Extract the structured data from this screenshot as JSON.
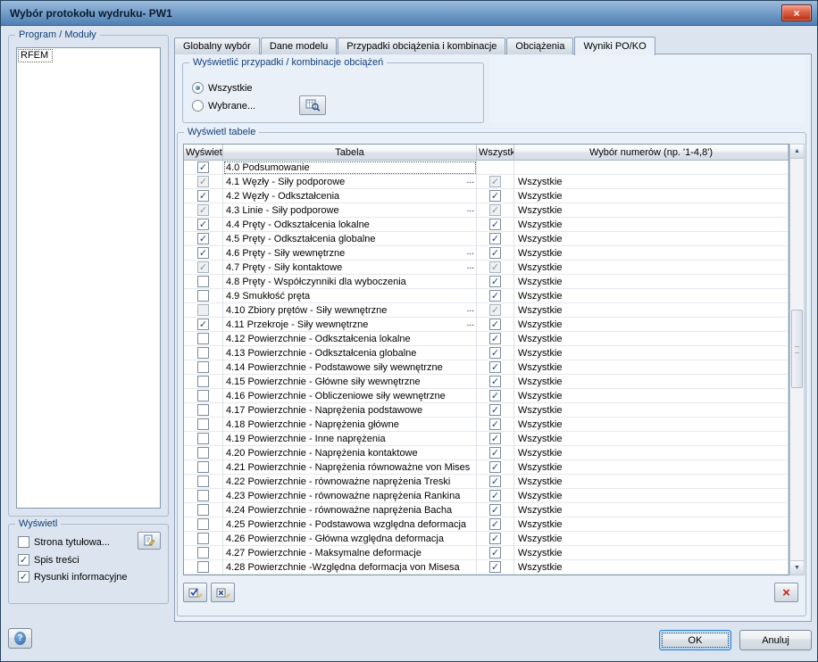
{
  "window": {
    "title": "Wybór protokołu wydruku- PW1"
  },
  "icons": {
    "close": "×",
    "help": "?",
    "dots": "...",
    "scroll_up": "▲",
    "scroll_down": "▼",
    "delete": "×"
  },
  "left": {
    "program_group": "Program / Moduły",
    "program_items": [
      {
        "label": "RFEM",
        "focused": true
      }
    ],
    "display_group": "Wyświetl",
    "options": [
      {
        "label": "Strona tytułowa...",
        "checked": false
      },
      {
        "label": "Spis treści",
        "checked": true
      },
      {
        "label": "Rysunki informacyjne",
        "checked": true
      }
    ]
  },
  "tabs": [
    {
      "label": "Globalny wybór",
      "active": false
    },
    {
      "label": "Dane modelu",
      "active": false
    },
    {
      "label": "Przypadki obciążenia i kombinacje",
      "active": false
    },
    {
      "label": "Obciążenia",
      "active": false
    },
    {
      "label": "Wyniki PO/KO",
      "active": true
    }
  ],
  "cases_group": {
    "label": "Wyświetlić przypadki / kombinacje obciążeń",
    "options": [
      {
        "label": "Wszystkie",
        "selected": true
      },
      {
        "label": "Wybrane...",
        "selected": false
      }
    ]
  },
  "tables_group": {
    "label": "Wyświetl tabele",
    "columns": [
      "Wyświetl",
      "Tabela",
      "Wszystkie",
      "Wybór numerów (np. '1-4,8')"
    ],
    "rows": [
      {
        "title": "4.0 Podsumowanie",
        "display": true,
        "display_disabled": false,
        "dots": false,
        "all": null,
        "all_disabled": false,
        "selection": "",
        "focused": true
      },
      {
        "title": "4.1 Węzły - Siły podporowe",
        "display": true,
        "display_disabled": true,
        "dots": true,
        "all": true,
        "all_disabled": true,
        "selection": "Wszystkie",
        "focused": false
      },
      {
        "title": "4.2 Węzły - Odkształcenia",
        "display": true,
        "display_disabled": false,
        "dots": false,
        "all": true,
        "all_disabled": false,
        "selection": "Wszystkie",
        "focused": false
      },
      {
        "title": "4.3 Linie - Siły podporowe",
        "display": true,
        "display_disabled": true,
        "dots": true,
        "all": true,
        "all_disabled": true,
        "selection": "Wszystkie",
        "focused": false
      },
      {
        "title": "4.4 Pręty - Odkształcenia lokalne",
        "display": true,
        "display_disabled": false,
        "dots": false,
        "all": true,
        "all_disabled": false,
        "selection": "Wszystkie",
        "focused": false
      },
      {
        "title": "4.5 Pręty - Odkształcenia globalne",
        "display": true,
        "display_disabled": false,
        "dots": false,
        "all": true,
        "all_disabled": false,
        "selection": "Wszystkie",
        "focused": false
      },
      {
        "title": "4.6 Pręty - Siły wewnętrzne",
        "display": true,
        "display_disabled": false,
        "dots": true,
        "all": true,
        "all_disabled": false,
        "selection": "Wszystkie",
        "focused": false
      },
      {
        "title": "4.7 Pręty - Siły kontaktowe",
        "display": true,
        "display_disabled": true,
        "dots": true,
        "all": true,
        "all_disabled": true,
        "selection": "Wszystkie",
        "focused": false
      },
      {
        "title": "4.8 Pręty - Współczynniki dla wyboczenia",
        "display": false,
        "display_disabled": false,
        "dots": false,
        "all": true,
        "all_disabled": false,
        "selection": "Wszystkie",
        "focused": false
      },
      {
        "title": "4.9 Smukłość pręta",
        "display": false,
        "display_disabled": false,
        "dots": false,
        "all": true,
        "all_disabled": false,
        "selection": "Wszystkie",
        "focused": false
      },
      {
        "title": "4.10 Zbiory prętów - Siły wewnętrzne",
        "display": false,
        "display_disabled": true,
        "dots": true,
        "all": true,
        "all_disabled": true,
        "selection": "Wszystkie",
        "focused": false
      },
      {
        "title": "4.11 Przekroje - Siły wewnętrzne",
        "display": true,
        "display_disabled": false,
        "dots": true,
        "all": true,
        "all_disabled": false,
        "selection": "Wszystkie",
        "focused": false
      },
      {
        "title": "4.12 Powierzchnie - Odkształcenia lokalne",
        "display": false,
        "display_disabled": false,
        "dots": false,
        "all": true,
        "all_disabled": false,
        "selection": "Wszystkie",
        "focused": false
      },
      {
        "title": "4.13 Powierzchnie - Odkształcenia globalne",
        "display": false,
        "display_disabled": false,
        "dots": false,
        "all": true,
        "all_disabled": false,
        "selection": "Wszystkie",
        "focused": false
      },
      {
        "title": "4.14 Powierzchnie - Podstawowe siły wewnętrzne",
        "display": false,
        "display_disabled": false,
        "dots": false,
        "all": true,
        "all_disabled": false,
        "selection": "Wszystkie",
        "focused": false
      },
      {
        "title": "4.15 Powierzchnie - Główne siły wewnętrzne",
        "display": false,
        "display_disabled": false,
        "dots": false,
        "all": true,
        "all_disabled": false,
        "selection": "Wszystkie",
        "focused": false
      },
      {
        "title": "4.16 Powierzchnie - Obliczeniowe siły wewnętrzne",
        "display": false,
        "display_disabled": false,
        "dots": false,
        "all": true,
        "all_disabled": false,
        "selection": "Wszystkie",
        "focused": false
      },
      {
        "title": "4.17 Powierzchnie - Naprężenia podstawowe",
        "display": false,
        "display_disabled": false,
        "dots": false,
        "all": true,
        "all_disabled": false,
        "selection": "Wszystkie",
        "focused": false
      },
      {
        "title": "4.18 Powierzchnie - Naprężenia główne",
        "display": false,
        "display_disabled": false,
        "dots": false,
        "all": true,
        "all_disabled": false,
        "selection": "Wszystkie",
        "focused": false
      },
      {
        "title": "4.19 Powierzchnie - Inne naprężenia",
        "display": false,
        "display_disabled": false,
        "dots": false,
        "all": true,
        "all_disabled": false,
        "selection": "Wszystkie",
        "focused": false
      },
      {
        "title": "4.20 Powierzchnie - Naprężenia kontaktowe",
        "display": false,
        "display_disabled": false,
        "dots": false,
        "all": true,
        "all_disabled": false,
        "selection": "Wszystkie",
        "focused": false
      },
      {
        "title": "4.21 Powierzchnie - Naprężenia równoważne von Mises",
        "display": false,
        "display_disabled": false,
        "dots": false,
        "all": true,
        "all_disabled": false,
        "selection": "Wszystkie",
        "focused": false
      },
      {
        "title": "4.22 Powierzchnie - równoważne naprężenia Treski",
        "display": false,
        "display_disabled": false,
        "dots": false,
        "all": true,
        "all_disabled": false,
        "selection": "Wszystkie",
        "focused": false
      },
      {
        "title": "4.23 Powierzchnie - równoważne naprężenia Rankina",
        "display": false,
        "display_disabled": false,
        "dots": false,
        "all": true,
        "all_disabled": false,
        "selection": "Wszystkie",
        "focused": false
      },
      {
        "title": "4.24 Powierzchnie - równoważne naprężenia Bacha",
        "display": false,
        "display_disabled": false,
        "dots": false,
        "all": true,
        "all_disabled": false,
        "selection": "Wszystkie",
        "focused": false
      },
      {
        "title": "4.25 Powierzchnie - Podstawowa względna deformacja",
        "display": false,
        "display_disabled": false,
        "dots": false,
        "all": true,
        "all_disabled": false,
        "selection": "Wszystkie",
        "focused": false
      },
      {
        "title": "4.26 Powierzchnie - Główna względna deformacja",
        "display": false,
        "display_disabled": false,
        "dots": false,
        "all": true,
        "all_disabled": false,
        "selection": "Wszystkie",
        "focused": false
      },
      {
        "title": "4.27 Powierzchnie - Maksymalne deformacje",
        "display": false,
        "display_disabled": false,
        "dots": false,
        "all": true,
        "all_disabled": false,
        "selection": "Wszystkie",
        "focused": false
      },
      {
        "title": "4.28 Powierzchnie -Względna deformacja von Misesa",
        "display": false,
        "display_disabled": false,
        "dots": false,
        "all": true,
        "all_disabled": false,
        "selection": "Wszystkie",
        "focused": false
      }
    ]
  },
  "footer": {
    "ok": "OK",
    "cancel": "Anuluj"
  }
}
